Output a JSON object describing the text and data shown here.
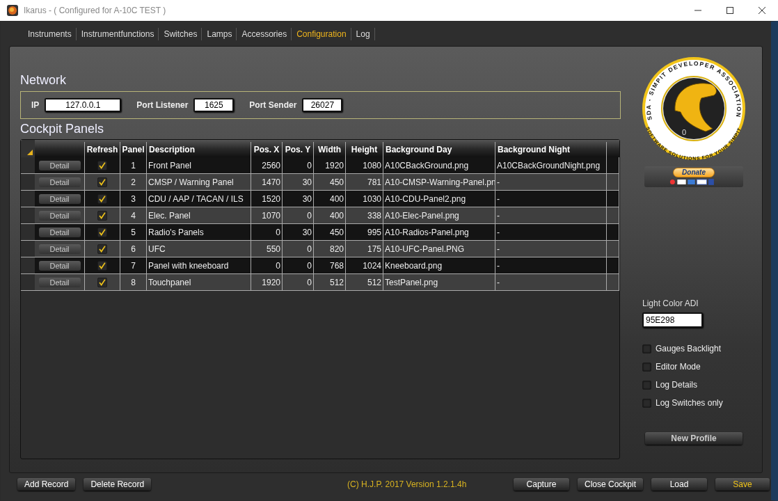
{
  "window": {
    "title": "Ikarus - ( Configured for A-10C TEST )"
  },
  "tabs": [
    {
      "label": "Instruments",
      "selected": false
    },
    {
      "label": "Instrumentfunctions",
      "selected": false
    },
    {
      "label": "Switches",
      "selected": false
    },
    {
      "label": "Lamps",
      "selected": false
    },
    {
      "label": "Accessories",
      "selected": false
    },
    {
      "label": "Configuration",
      "selected": true
    },
    {
      "label": "Log",
      "selected": false
    }
  ],
  "network": {
    "title": "Network",
    "fields": [
      {
        "label": "IP",
        "value": "127.0.0.1"
      },
      {
        "label": "Port Listener",
        "value": "1625"
      },
      {
        "label": "Port Sender",
        "value": "26027"
      }
    ]
  },
  "cockpit_panels": {
    "title": "Cockpit Panels",
    "table": {
      "columns": [
        "",
        "Refresh",
        "Panel",
        "Description",
        "Pos. X",
        "Pos. Y",
        "Width",
        "Height",
        "Background Day",
        "Background Night"
      ],
      "rows": [
        {
          "cells": [
            {
              "kind": "button",
              "text": "Detail"
            },
            {
              "kind": "checkbox",
              "checked": true
            },
            "1",
            "Front Panel",
            "2560",
            "0",
            "1920",
            "1080",
            "A10CBackGround.png",
            "A10CBackGroundNight.png"
          ]
        },
        {
          "cells": [
            {
              "kind": "button",
              "text": "Detail"
            },
            {
              "kind": "checkbox",
              "checked": true
            },
            "2",
            "CMSP / Warning Panel",
            "1470",
            "30",
            "450",
            "781",
            "A10-CMSP-Warning-Panel.pn",
            "-"
          ]
        },
        {
          "cells": [
            {
              "kind": "button",
              "text": "Detail"
            },
            {
              "kind": "checkbox",
              "checked": true
            },
            "3",
            "CDU / AAP / TACAN / ILS",
            "1520",
            "30",
            "400",
            "1030",
            "A10-CDU-Panel2.png",
            "-"
          ]
        },
        {
          "cells": [
            {
              "kind": "button",
              "text": "Detail"
            },
            {
              "kind": "checkbox",
              "checked": true
            },
            "4",
            "Elec. Panel",
            "1070",
            "0",
            "400",
            "338",
            "A10-Elec-Panel.png",
            "-"
          ]
        },
        {
          "cells": [
            {
              "kind": "button",
              "text": "Detail"
            },
            {
              "kind": "checkbox",
              "checked": true
            },
            "5",
            "Radio's Panels",
            "0",
            "30",
            "450",
            "995",
            "A10-Radios-Panel.png",
            "-"
          ]
        },
        {
          "cells": [
            {
              "kind": "button",
              "text": "Detail"
            },
            {
              "kind": "checkbox",
              "checked": true
            },
            "6",
            "UFC",
            "550",
            "0",
            "820",
            "175",
            "A10-UFC-Panel.PNG",
            "-"
          ]
        },
        {
          "cells": [
            {
              "kind": "button",
              "text": "Detail"
            },
            {
              "kind": "checkbox",
              "checked": true
            },
            "7",
            "Panel with kneeboard",
            "0",
            "0",
            "768",
            "1024",
            "Kneeboard.png",
            "-"
          ]
        },
        {
          "cells": [
            {
              "kind": "button",
              "text": "Detail"
            },
            {
              "kind": "checkbox",
              "checked": true
            },
            "8",
            "Touchpanel",
            "1920",
            "0",
            "512",
            "512",
            "TestPanel.png",
            "-"
          ]
        }
      ]
    }
  },
  "logo": {
    "top_text": "SDA - SIMPIT DEVELOPER ASSOCIATION",
    "bottom_text": "SOFTWARE SOLUTIONS FOR YOUR SIMPIT",
    "dial_number": "0"
  },
  "donate": {
    "label": "Donate"
  },
  "light_color": {
    "label": "Light Color ADI",
    "value": "95E298"
  },
  "options": [
    {
      "label": "Gauges Backlight",
      "checked": false
    },
    {
      "label": "Editor Mode",
      "checked": false
    },
    {
      "label": "Log Details",
      "checked": false
    },
    {
      "label": "Log Switches only",
      "checked": false
    }
  ],
  "new_profile": "New Profile",
  "footer": {
    "left_buttons": [
      "Add Record",
      "Delete Record"
    ],
    "copyright": "(C) H.J.P. 2017  Version 1.2.1.4h",
    "right_buttons": [
      {
        "label": "Capture",
        "accent": false
      },
      {
        "label": "Close Cockpit",
        "accent": false
      },
      {
        "label": "Load",
        "accent": false
      },
      {
        "label": "Save",
        "accent": true
      }
    ]
  }
}
